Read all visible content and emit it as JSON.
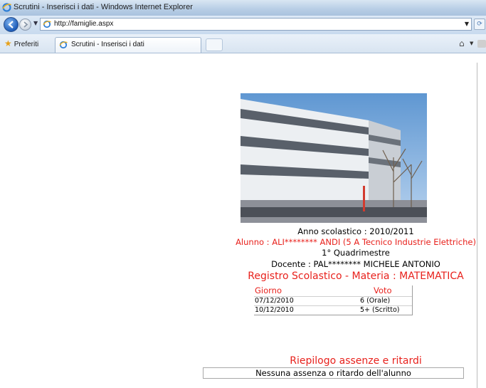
{
  "window": {
    "title": "Scrutini - Inserisci i dati - Windows Internet Explorer",
    "icon": "ie-icon"
  },
  "address_bar": {
    "url": "http://famiglie.aspx"
  },
  "favorites_bar": {
    "favorites_label": "Preferiti",
    "tab_label": "Scrutini - Inserisci i dati"
  },
  "page": {
    "school_photo": "school-building-photo",
    "school_year": "Anno scolastico : 2010/2011",
    "student": "Alunno : ALI******** ANDI (5 A Tecnico Industrie Elettriche)",
    "term": "1° Quadrimestre",
    "teacher": "Docente : PAL******** MICHELE ANTONIO",
    "register_title": "Registro Scolastico - Materia : MATEMATICA",
    "grades_table": {
      "headers": [
        "Giorno",
        "Voto"
      ],
      "rows": [
        [
          "07/12/2010",
          "6 (Orale)"
        ],
        [
          "10/12/2010",
          "5+ (Scritto)"
        ]
      ]
    },
    "absences_title": "Riepilogo assenze e ritardi",
    "absences_message": "Nessuna assenza o ritardo dell'alunno"
  },
  "colors": {
    "accent_red": "#e8211c",
    "titlebar_blue": "#b9cfe6"
  }
}
